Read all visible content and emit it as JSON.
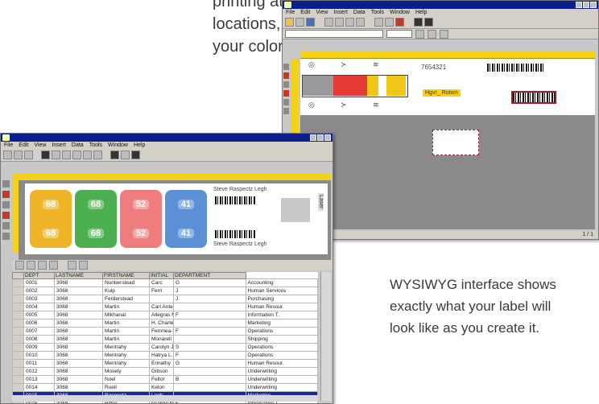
{
  "copy_top": [
    "printing at multiple",
    "locations, ColorBar meets",
    "your color labeling needs."
  ],
  "copy_bottom": [
    "WYSIWYG interface shows",
    "exactly what your label will",
    "look like as you create it."
  ],
  "back_window": {
    "menu": [
      "File",
      "Edit",
      "View",
      "Insert",
      "Data",
      "Tools",
      "Window",
      "Help"
    ],
    "label": {
      "number_text": "7654321",
      "name_tag": "Hgvr_ Rotxm",
      "status": "1 / 1"
    },
    "segments": [
      "#999999",
      "#e53935",
      "#f2c618",
      "#ffffff",
      "#f2c618"
    ]
  },
  "front_window": {
    "menu": [
      "File",
      "Edit",
      "View",
      "Insert",
      "Data",
      "Tools",
      "Window",
      "Help"
    ],
    "chips": [
      {
        "color": "#f0b429",
        "top": "68",
        "bottom": "68"
      },
      {
        "color": "#4caf50",
        "top": "68",
        "bottom": "68"
      },
      {
        "color": "#ef7d7d",
        "top": "52",
        "bottom": "52"
      },
      {
        "color": "#5b8fd6",
        "top": "41",
        "bottom": "41"
      }
    ],
    "label_name_top": "Steve Raspectz Legh",
    "label_name_bottom": "Steve Raspectz Legh",
    "sidebar_word": "Laser",
    "grid": {
      "headers": [
        "",
        "DEPT",
        "LASTNAME",
        "FIRSTNAME",
        "INITIAL",
        "DEPARTMENT"
      ],
      "rows": [
        [
          "0001",
          "3068",
          "Nunberstead",
          "Carc",
          "G",
          "Accounting"
        ],
        [
          "0002",
          "3068",
          "Kulp",
          "Ferri",
          "J",
          "Human Services"
        ],
        [
          "0003",
          "3068",
          "Ferderstead",
          "",
          "J",
          "Purchasing"
        ],
        [
          "0004",
          "3068",
          "Martin",
          "Carl Ante",
          "",
          "Human Resour."
        ],
        [
          "0005",
          "3068",
          "Mikhanal",
          "Allegras M.",
          "F",
          "Information T."
        ],
        [
          "0006",
          "3068",
          "Martin",
          "H. Charles",
          "",
          "Marketing"
        ],
        [
          "0007",
          "3068",
          "Martin",
          "Fernnea-Ellen",
          "F",
          "Operations"
        ],
        [
          "0008",
          "3068",
          "Martin",
          "Monarell",
          "",
          "Shipping"
        ],
        [
          "0009",
          "3068",
          "Mentrahy",
          "Carolyn Joe",
          "S",
          "Operations"
        ],
        [
          "0010",
          "3068",
          "Mentrahy",
          "Hatrya L.",
          "F",
          "Operations"
        ],
        [
          "0011",
          "3068",
          "Mentrahy",
          "Erinathy",
          "G",
          "Human Resour."
        ],
        [
          "0012",
          "3068",
          "Mosely",
          "Gibson",
          "",
          "Underwriting"
        ],
        [
          "0013",
          "3068",
          "Noel",
          "Feltor",
          "B",
          "Underwriting"
        ],
        [
          "0014",
          "3068",
          "Ruell",
          "Kelon",
          "",
          "Underwriting"
        ],
        [
          "0015",
          "3068",
          "Raspectz",
          "Legh",
          "",
          "Marketing"
        ],
        [
          "0016",
          "3068",
          "Ritter",
          "Grahlin Mnck",
          "F",
          "Information T."
        ]
      ],
      "selected_index": 14
    }
  }
}
